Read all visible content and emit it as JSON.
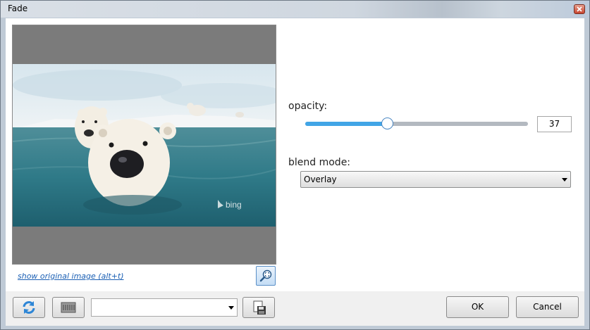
{
  "window": {
    "title": "Fade",
    "close_icon": "close-icon"
  },
  "preview": {
    "watermark": "bing",
    "show_original_link": "show original image (alt+t)",
    "zoom_icon": "magnifier-fit-icon"
  },
  "opacity": {
    "label": "opacity:",
    "value": "37",
    "fraction": 0.37,
    "accent": "#41a5e6"
  },
  "blend": {
    "label": "blend mode:",
    "selected": "Overlay"
  },
  "toolbar": {
    "reset_icon": "refresh-icon",
    "presets_icon": "presets-icon",
    "preset_value": "",
    "save_icon": "save-preset-icon"
  },
  "actions": {
    "ok": "OK",
    "cancel": "Cancel"
  }
}
